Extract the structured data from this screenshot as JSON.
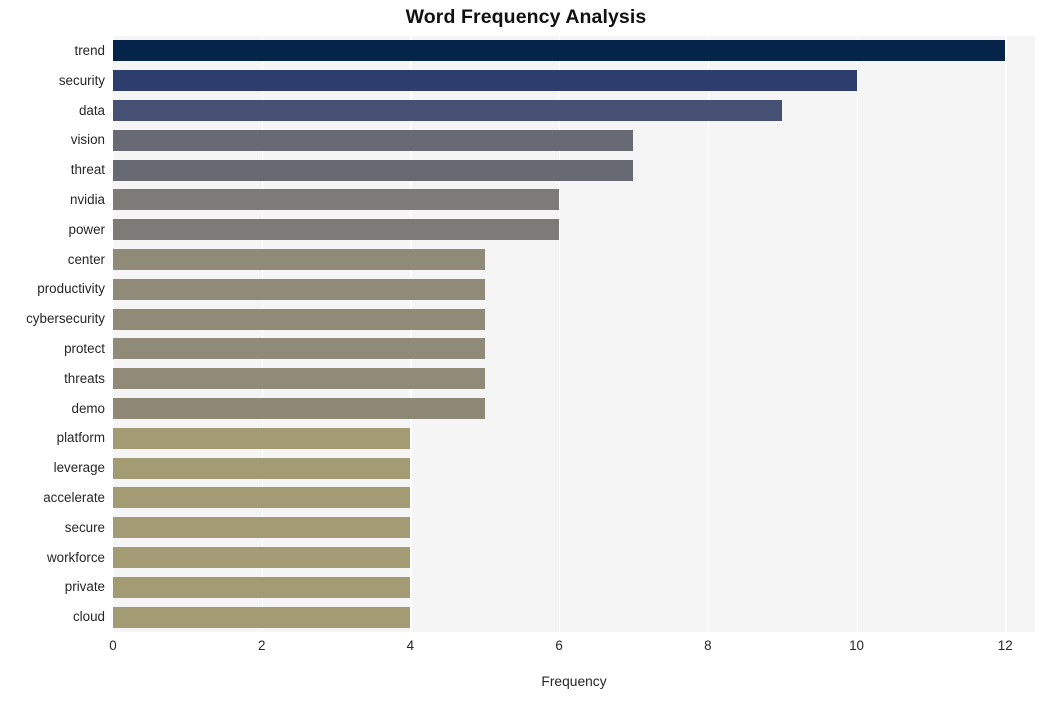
{
  "chart_data": {
    "type": "bar",
    "orientation": "horizontal",
    "title": "Word Frequency Analysis",
    "xlabel": "Frequency",
    "ylabel": "",
    "xlim": [
      0,
      12.4
    ],
    "ylim": [
      0,
      20
    ],
    "grid": true,
    "legend": null,
    "xticks": [
      "0",
      "2",
      "4",
      "6",
      "8",
      "10",
      "12"
    ],
    "xtick_values": [
      0,
      2,
      4,
      6,
      8,
      10,
      12
    ],
    "categories": [
      "trend",
      "security",
      "data",
      "vision",
      "threat",
      "nvidia",
      "power",
      "center",
      "productivity",
      "cybersecurity",
      "protect",
      "threats",
      "demo",
      "platform",
      "leverage",
      "accelerate",
      "secure",
      "workforce",
      "private",
      "cloud"
    ],
    "values": [
      12,
      10,
      9,
      7,
      7,
      6,
      6,
      5,
      5,
      5,
      5,
      5,
      5,
      4,
      4,
      4,
      4,
      4,
      4,
      4
    ],
    "bar_colors": [
      "#042449",
      "#2d3e6e",
      "#465173",
      "#676a72",
      "#676a72",
      "#7c7b77",
      "#7c7b77",
      "#908a79",
      "#908a79",
      "#908a79",
      "#908a79",
      "#908a79",
      "#8e8877",
      "#a39b74",
      "#a39b74",
      "#a39b74",
      "#a39b74",
      "#a39b74",
      "#a39b74",
      "#a39b74"
    ],
    "plot_background": "#f5f5f6",
    "gridline_color": "#ffffff",
    "figure_background": "#ffffff",
    "text_color": "#262626",
    "title_color": "#111111"
  }
}
